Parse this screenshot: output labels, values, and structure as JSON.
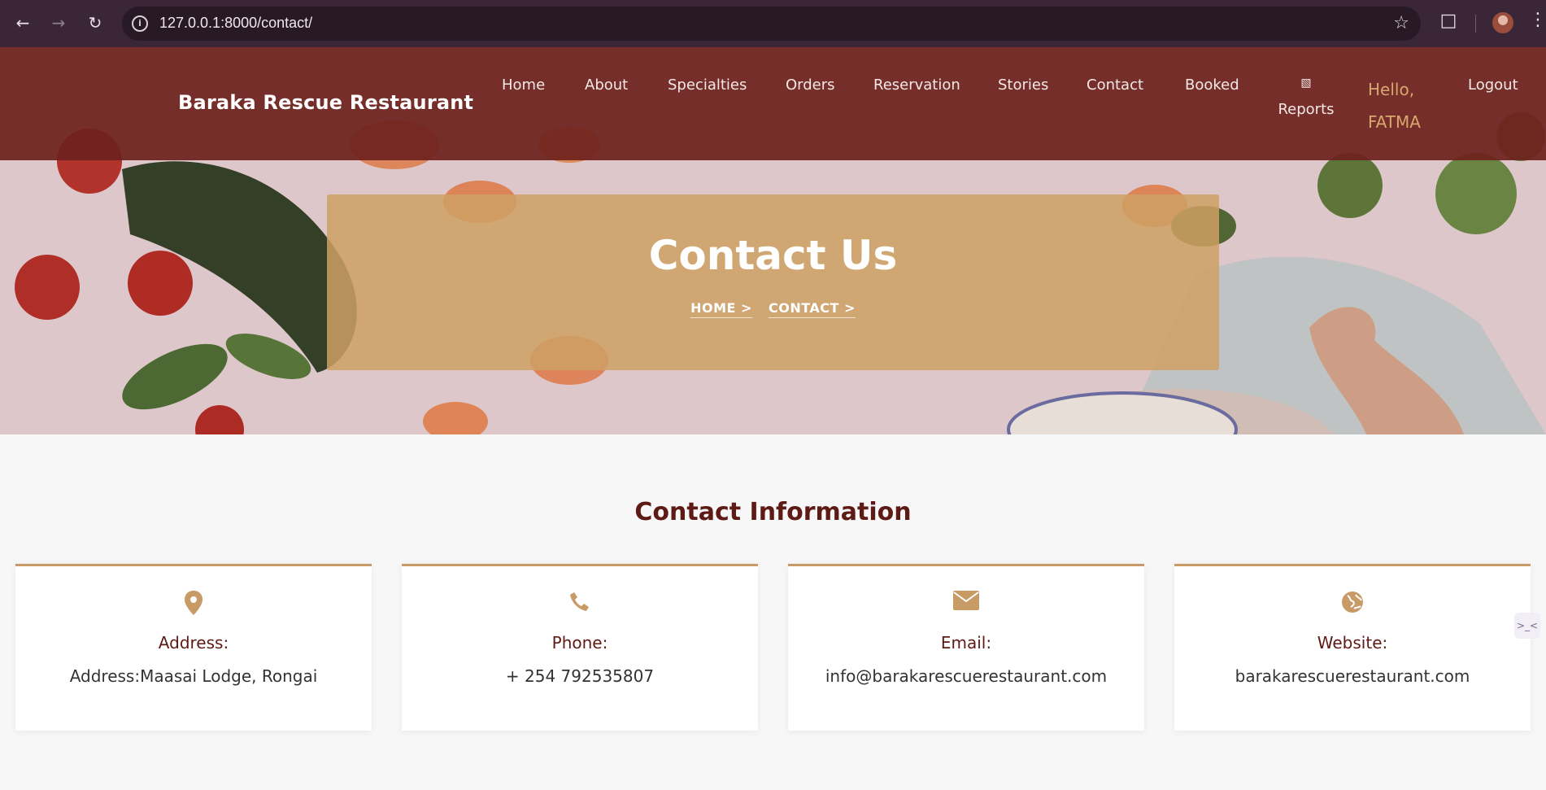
{
  "browser": {
    "url": "127.0.0.1:8000/contact/",
    "icons": [
      "back-icon",
      "forward-icon",
      "reload-icon",
      "site-info-icon",
      "bookmark-star-icon",
      "extensions-icon",
      "profile-avatar",
      "menu-icon"
    ]
  },
  "navbar": {
    "brand": "Baraka Rescue Restaurant",
    "links": [
      "Home",
      "About",
      "Specialties",
      "Orders",
      "Reservation",
      "Stories",
      "Contact",
      "Booked"
    ],
    "reports": "Reports",
    "hello": "Hello,",
    "user": "FATMA",
    "logout": "Logout"
  },
  "hero": {
    "title": "Contact Us",
    "breadcrumbs": [
      "HOME >",
      "CONTACT >"
    ]
  },
  "contact": {
    "title": "Contact Information",
    "cards": [
      {
        "icon": "map-pin-icon",
        "label": "Address:",
        "value": "Address:Maasai Lodge, Rongai"
      },
      {
        "icon": "phone-icon",
        "label": "Phone:",
        "value": "+ 254 792535807"
      },
      {
        "icon": "envelope-icon",
        "label": "Email:",
        "value": "info@barakarescuerestaurant.com"
      },
      {
        "icon": "globe-icon",
        "label": "Website:",
        "value": "barakarescuerestaurant.com"
      }
    ]
  },
  "colors": {
    "navbar": "#6e221e",
    "accent": "#c79a66",
    "heading": "#5e1a14"
  }
}
